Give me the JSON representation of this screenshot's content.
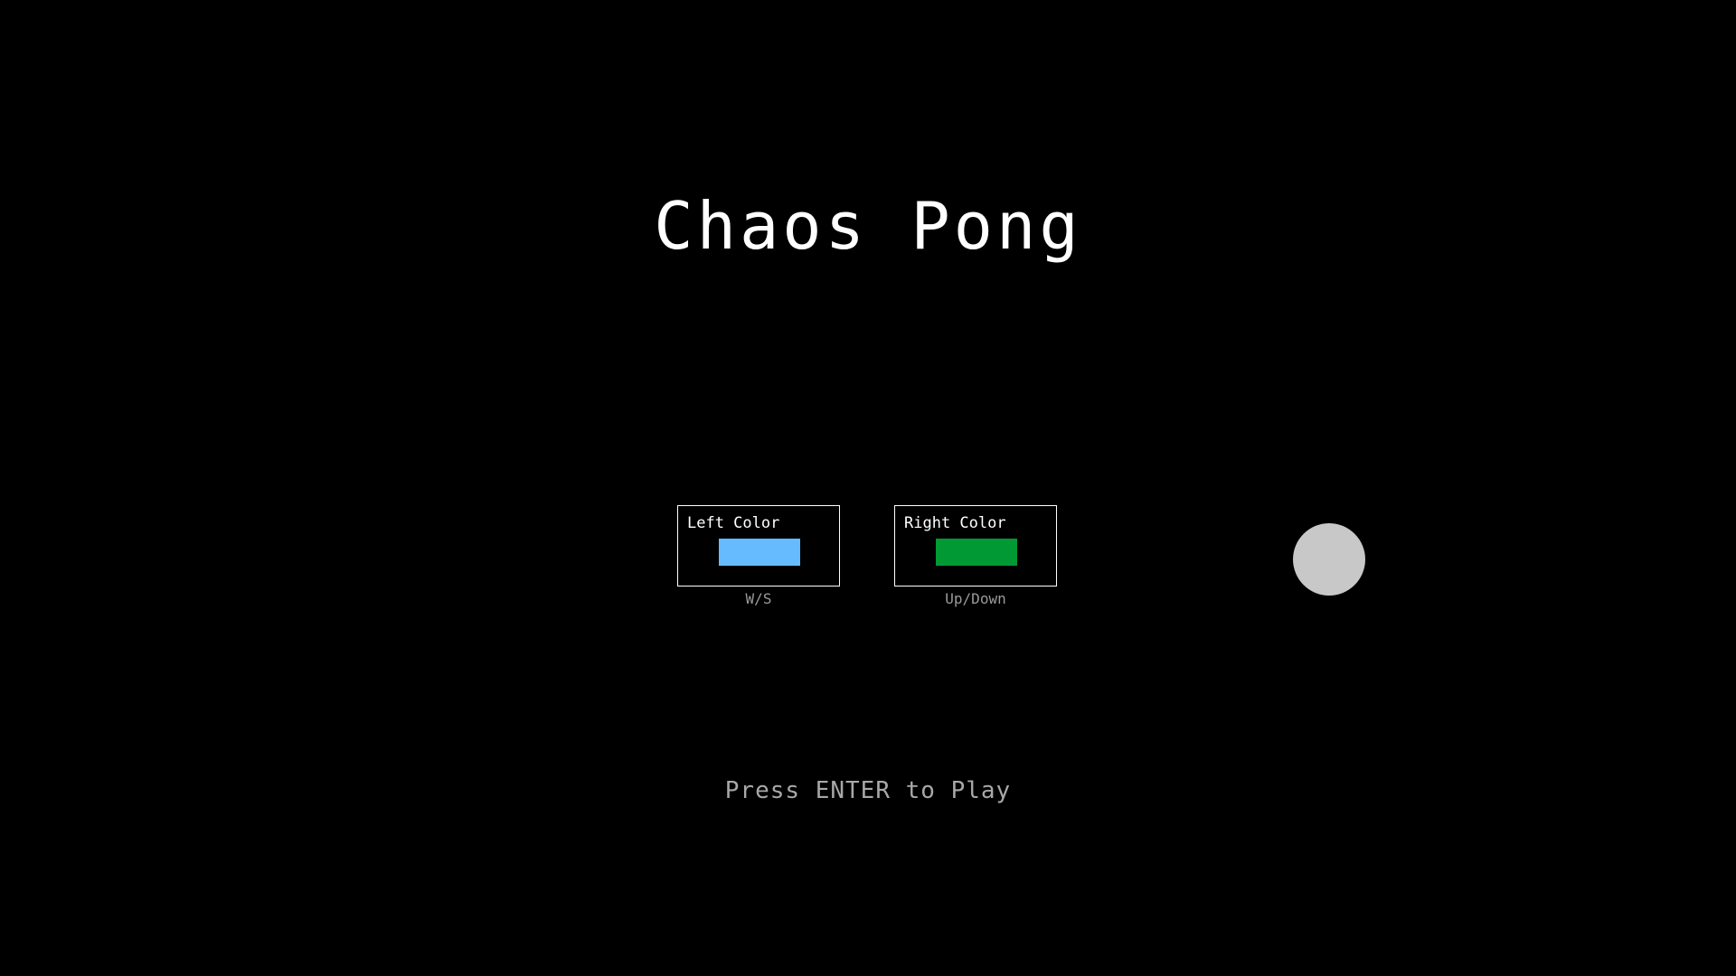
{
  "title": "Chaos Pong",
  "left_player": {
    "label": "Left Color",
    "swatch_color": "#66bbff",
    "controls": "W/S"
  },
  "right_player": {
    "label": "Right Color",
    "swatch_color": "#009933",
    "controls": "Up/Down"
  },
  "ball": {
    "color": "#c8c8c8"
  },
  "prompt": "Press ENTER to Play",
  "colors": {
    "background": "#000000",
    "title": "#ffffff",
    "panel_border": "#ffffff",
    "hint_text": "#9a9a9a",
    "prompt_text": "#a8a8a8"
  }
}
